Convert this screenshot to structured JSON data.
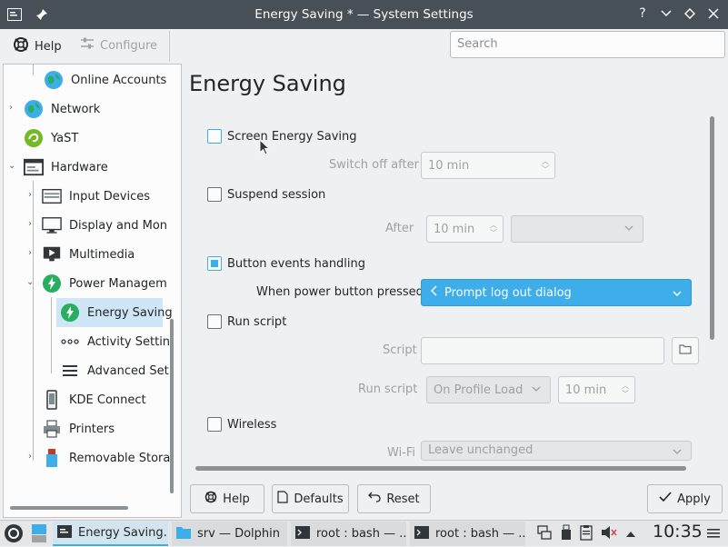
{
  "window": {
    "title": "Energy Saving * — System Settings",
    "buttons": [
      "help-icon",
      "minimize-icon",
      "maximize-icon",
      "close-icon"
    ]
  },
  "toolbar": {
    "help_label": "Help",
    "configure_label": "Configure",
    "search_placeholder": "Search"
  },
  "sidebar": {
    "items": [
      {
        "label": "Online Accounts",
        "icon": "globe-icon"
      },
      {
        "label": "Network",
        "icon": "globe-icon"
      },
      {
        "label": "YaST",
        "icon": "yast-icon"
      },
      {
        "label": "Hardware",
        "icon": "hardware-icon"
      },
      {
        "label": "Input Devices",
        "icon": "keyboard-icon"
      },
      {
        "label": "Display and Mon",
        "icon": "monitor-icon"
      },
      {
        "label": "Multimedia",
        "icon": "multimedia-icon"
      },
      {
        "label": "Power Managem",
        "icon": "power-icon"
      },
      {
        "label": "Energy Saving",
        "icon": "power-icon"
      },
      {
        "label": "Activity Settin",
        "icon": "dots-icon"
      },
      {
        "label": "Advanced Set",
        "icon": "menu-icon"
      },
      {
        "label": "KDE Connect",
        "icon": "phone-icon"
      },
      {
        "label": "Printers",
        "icon": "printer-icon"
      },
      {
        "label": "Removable Stora",
        "icon": "usb-icon"
      }
    ]
  },
  "main": {
    "title": "Energy Saving",
    "screen_energy_saving": {
      "label": "Screen Energy Saving",
      "checked": false
    },
    "switch_off_after": {
      "label": "Switch off after",
      "value": "10 min"
    },
    "suspend_session": {
      "label": "Suspend session",
      "checked": false
    },
    "after": {
      "label": "After",
      "value": "10 min",
      "combo": ""
    },
    "button_events": {
      "label": "Button events handling",
      "checked": true
    },
    "power_button": {
      "label": "When power button pressed",
      "value": "Prompt log out dialog"
    },
    "run_script": {
      "label": "Run script",
      "checked": false
    },
    "script": {
      "label": "Script",
      "value": ""
    },
    "run_script_when": {
      "label": "Run script",
      "value": "On Profile Load",
      "time": "10 min"
    },
    "wireless": {
      "label": "Wireless",
      "checked": false
    },
    "wifi": {
      "label": "Wi-Fi",
      "value": "Leave unchanged"
    }
  },
  "footer": {
    "help_label": "Help",
    "defaults_label": "Defaults",
    "reset_label": "Reset",
    "apply_label": "Apply"
  },
  "taskbar": {
    "tasks": [
      {
        "label": "Energy Saving..."
      },
      {
        "label": "srv — Dolphin"
      },
      {
        "label": "root : bash — ..."
      },
      {
        "label": "root : bash — ..."
      }
    ],
    "clock": "10:35"
  },
  "colors": {
    "accent": "#3daee9",
    "titlebar": "#475057",
    "selection": "#cfe6f7"
  }
}
